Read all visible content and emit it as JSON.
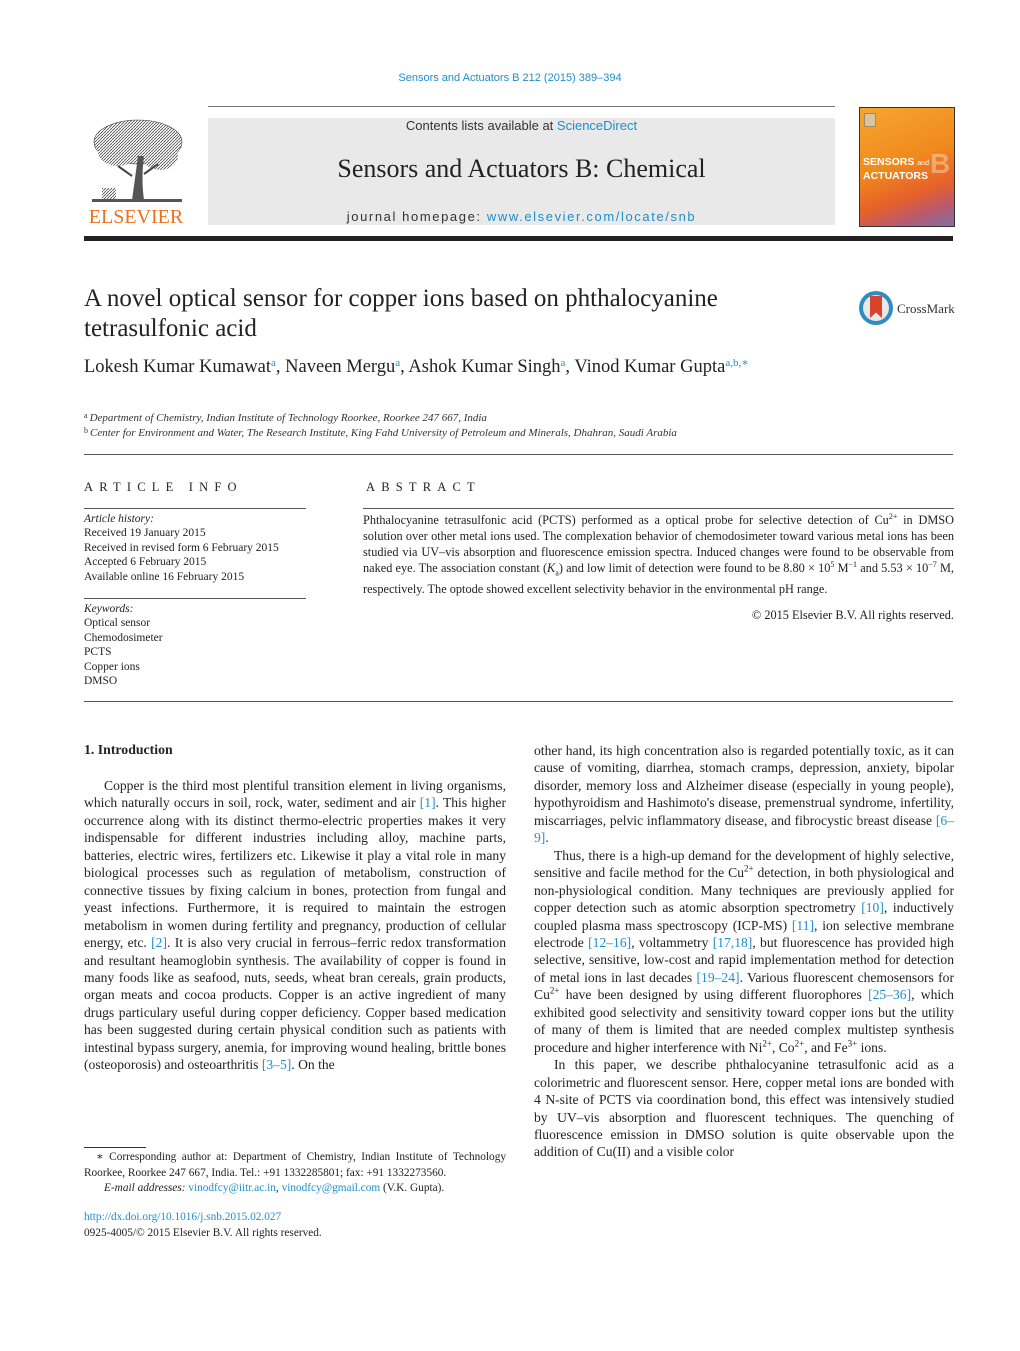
{
  "header": {
    "citation": "Sensors and Actuators B 212 (2015) 389–394",
    "contents_prefix": "Contents lists available at ",
    "contents_link": "ScienceDirect",
    "journal_title": "Sensors and Actuators B: Chemical",
    "homepage_prefix": "journal homepage: ",
    "homepage_link": "www.elsevier.com/locate/snb",
    "publisher_logo_text": "ELSEVIER",
    "cover_line1": "SENSORS",
    "cover_and": "and",
    "cover_line2": "ACTUATORS",
    "cover_letter": "B",
    "colors": {
      "link": "#1f8ec9",
      "elsevier_orange": "#e9711c",
      "masthead_bg": "#e9e9e9"
    }
  },
  "article": {
    "title": "A novel optical sensor for copper ions based on phthalocyanine tetrasulfonic acid",
    "crossmark_label": "CrossMark",
    "authors": [
      {
        "name": "Lokesh Kumar Kumawat",
        "sup": "a"
      },
      {
        "name": "Naveen Mergu",
        "sup": "a"
      },
      {
        "name": "Ashok Kumar Singh",
        "sup": "a"
      },
      {
        "name": "Vinod Kumar Gupta",
        "sup": "a,b,∗"
      }
    ],
    "affiliations": [
      {
        "sup": "a",
        "text": "Department of Chemistry, Indian Institute of Technology Roorkee, Roorkee 247 667, India"
      },
      {
        "sup": "b",
        "text": "Center for Environment and Water, The Research Institute, King Fahd University of Petroleum and Minerals, Dhahran, Saudi Arabia"
      }
    ]
  },
  "article_info": {
    "heading": "ARTICLE INFO",
    "history_label": "Article history:",
    "history": [
      "Received 19 January 2015",
      "Received in revised form 6 February 2015",
      "Accepted 6 February 2015",
      "Available online 16 February 2015"
    ],
    "keywords_label": "Keywords:",
    "keywords": [
      "Optical sensor",
      "Chemodosimeter",
      "PCTS",
      "Copper ions",
      "DMSO"
    ]
  },
  "abstract": {
    "heading": "ABSTRACT",
    "p1": "Phthalocyanine tetrasulfonic acid (PCTS) performed as a optical probe for selective detection of Cu",
    "p1_sup": "2+",
    "p2": " in DMSO solution over other metal ions used. The complexation behavior of chemodosimeter toward various metal ions has been studied via UV–vis absorption and fluorescence emission spectra. Induced changes were found to be observable from naked eye. The association constant (",
    "ka_k": "K",
    "ka_sub": "a",
    "p3": ") and low limit of detection were found to be 8.80 × 10",
    "exp1": "5",
    "p4": " M",
    "exp2": "−1",
    "p5": " and 5.53 × 10",
    "exp3": "−7",
    "p6": " M, respectively. The optode showed excellent selectivity behavior in the environmental pH range.",
    "copyright": "© 2015 Elsevier B.V. All rights reserved."
  },
  "intro": {
    "heading": "1.  Introduction",
    "left": {
      "a": "Copper is the third most plentiful transition element in living organisms, which naturally occurs in soil, rock, water, sediment and air ",
      "r1": "[1]",
      "b": ". This higher occurrence along with its distinct thermo-electric properties makes it very indispensable for different industries including alloy, machine parts, batteries, electric wires, fertilizers etc. Likewise it play a vital role in many biological processes such as regulation of metabolism, construction of connective tissues by fixing calcium in bones, protection from fungal and yeast infections. Furthermore, it is required to maintain the estrogen metabolism in women during fertility and pregnancy, production of cellular energy, etc. ",
      "r2": "[2]",
      "c": ". It is also very crucial in ferrous–ferric redox transformation and resultant heamoglobin synthesis. The availability of copper is found in many foods like as seafood, nuts, seeds, wheat bran cereals, grain products, organ meats and cocoa products. Copper is an active ingredient of many drugs particulary useful during copper deficiency. Copper based medication has been suggested during certain physical condition such as patients with intestinal bypass surgery, anemia, for improving wound healing, brittle bones (osteoporosis) and osteoarthritis ",
      "r3": "[3–5]",
      "d": ". On the"
    },
    "right": {
      "a": "other hand, its high concentration also is regarded potentially toxic, as it can cause of vomiting, diarrhea, stomach cramps, depression, anxiety, bipolar disorder, memory loss and Alzheimer disease (especially in young people), hypothyroidism and Hashimoto's disease, premenstrual syndrome, infertility, miscarriages, pelvic inflammatory disease, and fibrocystic breast disease ",
      "r69": "[6–9]",
      "b": ".",
      "p2a": "Thus, there is a high-up demand for the development of highly selective, sensitive and facile method for the Cu",
      "sup2": "2+",
      "p2b": " detection, in both physiological and non-physiological condition. Many techniques are previously applied for copper detection such as atomic absorption spectrometry ",
      "r10": "[10]",
      "p2c": ", inductively coupled plasma mass spectroscopy (ICP-MS) ",
      "r11": "[11]",
      "p2d": ", ion selective membrane electrode ",
      "r1216": "[12–16]",
      "p2e": ", voltammetry ",
      "r1718": "[17,18]",
      "p2f": ", but fluorescence has provided high selective, sensitive, low-cost and rapid implementation method for detection of metal ions in last decades ",
      "r1924": "[19–24]",
      "p2g": ". Various fluorescent chemosensors for Cu",
      "p2h": " have been designed by using different fluorophores ",
      "r2536": "[25–36]",
      "p2i": ", which exhibited good selectivity and sensitivity toward copper ions but the utility of many of them is limited that are needed complex multistep synthesis procedure and higher interference with Ni",
      "p2j": ", Co",
      "p2k": ", and Fe",
      "sup3": "3+",
      "p2l": " ions.",
      "p3": "In this paper, we describe phthalocyanine tetrasulfonic acid as a colorimetric and fluorescent sensor. Here, copper metal ions are bonded with 4 N-site of PCTS via coordination bond, this effect was intensively studied by UV–vis absorption and fluorescent techniques. The quenching of fluorescence emission in DMSO solution is quite observable upon the addition of Cu(II) and a visible color"
    }
  },
  "footnote": {
    "star": "∗",
    "corresponding": " Corresponding author at: Department of Chemistry, Indian Institute of Technology Roorkee, Roorkee 247 667, India. Tel.: +91 1332285801; fax: +91 1332273560.",
    "email_label": "E-mail addresses:",
    "email1": "vinodfcy@iitr.ac.in",
    "email2": "vinodfcy@gmail.com",
    "email_suffix": " (V.K. Gupta).",
    "doi": "http://dx.doi.org/10.1016/j.snb.2015.02.027",
    "issn": "0925-4005/© 2015 Elsevier B.V. All rights reserved."
  }
}
